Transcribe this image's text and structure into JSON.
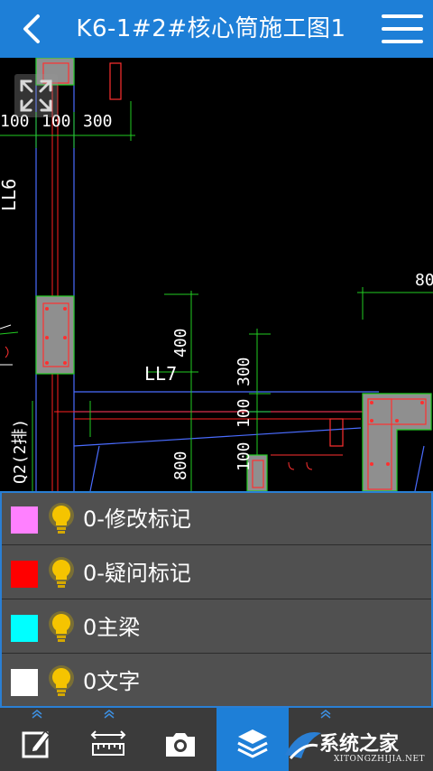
{
  "header": {
    "title": "K6-1#2#核心筒施工图1",
    "back_icon": "chevron-left-icon",
    "menu_icon": "hamburger-menu-icon",
    "color": "#1e7fd7"
  },
  "drawing": {
    "labels": {
      "dim_100_left": "100",
      "dim_100": "100",
      "dim_300": "300",
      "ll6": "LL6",
      "ll7": "LL7",
      "dim_400": "400",
      "dim_300_b": "300",
      "dim_100_b": "100",
      "dim_100_c": "100",
      "dim_800": "800",
      "dim_80": "80",
      "q2": "Q2(2排)"
    },
    "expand_icon": "fullscreen-expand-icon"
  },
  "layers": [
    {
      "color": "#ff80ff",
      "label": "0-修改标记"
    },
    {
      "color": "#ff0000",
      "label": "0-疑问标记"
    },
    {
      "color": "#00ffff",
      "label": "0主梁"
    },
    {
      "color": "#ffffff",
      "label": "0文字"
    }
  ],
  "toolbar": [
    {
      "icon": "edit-icon",
      "active": false
    },
    {
      "icon": "ruler-icon",
      "active": false
    },
    {
      "icon": "camera-icon",
      "active": false
    },
    {
      "icon": "layers-icon",
      "active": true
    }
  ],
  "watermark": {
    "text": "系统之家",
    "sub": "XITONGZHIJIA.NET"
  }
}
